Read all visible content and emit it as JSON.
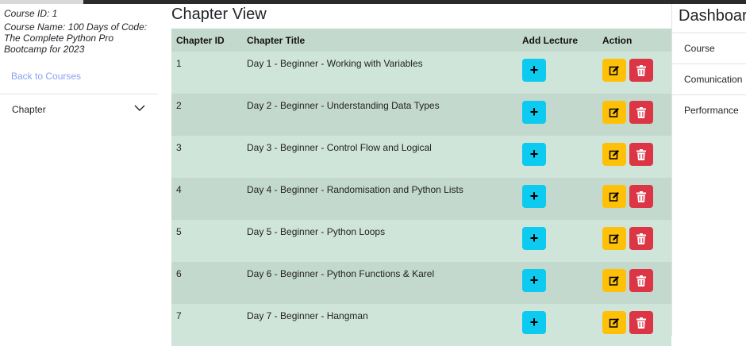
{
  "sidebar": {
    "course_id": "Course ID: 1",
    "course_name": "Course Name: 100 Days of Code: The Complete Python Pro Bootcamp for 2023",
    "back_link": "Back to Courses",
    "chapter_toggle": "Chapter"
  },
  "main": {
    "title": "Chapter View",
    "columns": {
      "id": "Chapter ID",
      "title": "Chapter Title",
      "add": "Add Lecture",
      "action": "Action"
    },
    "add_symbol": "+",
    "rows": [
      {
        "id": "1",
        "title": "Day 1 - Beginner - Working with Variables"
      },
      {
        "id": "2",
        "title": "Day 2 - Beginner - Understanding Data Types"
      },
      {
        "id": "3",
        "title": "Day 3 - Beginner - Control Flow and Logical"
      },
      {
        "id": "4",
        "title": "Day 4 - Beginner - Randomisation and Python Lists"
      },
      {
        "id": "5",
        "title": "Day 5 - Beginner - Python Loops"
      },
      {
        "id": "6",
        "title": "Day 6 - Beginner - Python Functions & Karel"
      },
      {
        "id": "7",
        "title": "Day 7 - Beginner - Hangman"
      }
    ]
  },
  "right": {
    "title": "Dashboard",
    "nav": [
      "Course",
      "Comunication",
      "Performance"
    ]
  },
  "icons": {
    "chevron": "chevron-down-icon",
    "add": "plus-icon",
    "edit": "edit-icon",
    "delete": "trash-icon"
  },
  "colors": {
    "add_button": "#0dcaf0",
    "edit_button": "#ffc107",
    "delete_button": "#dc3545",
    "row_light": "#d0e5da",
    "row_dark": "#c4d9cd",
    "link": "#8aa2f0"
  }
}
